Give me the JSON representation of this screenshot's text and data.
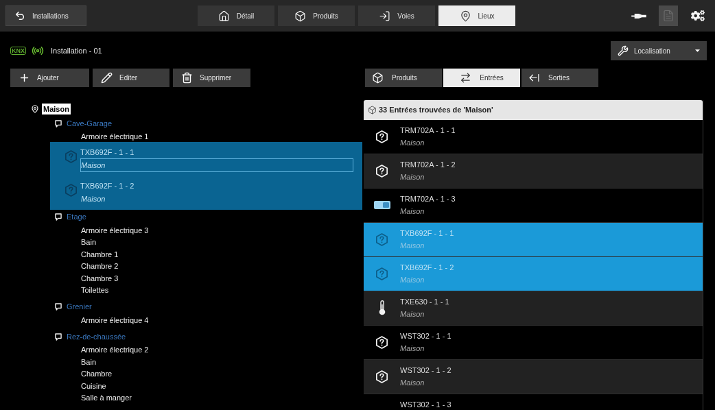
{
  "top_bar": {
    "back_button": "Installations",
    "tabs": [
      {
        "label": "Détail",
        "selected": false
      },
      {
        "label": "Produits",
        "selected": false
      },
      {
        "label": "Voies",
        "selected": false
      },
      {
        "label": "Lieux",
        "selected": true
      }
    ],
    "tools": [
      {
        "kind": "plug",
        "disabled": false
      },
      {
        "kind": "document",
        "disabled": true
      },
      {
        "kind": "settings",
        "disabled": false
      }
    ]
  },
  "installation": {
    "logo": "KNX",
    "name": "Installation - 01"
  },
  "view_menu": {
    "label": "Localisation"
  },
  "actions": [
    "Ajouter",
    "Editer",
    "Supprimer"
  ],
  "filter_tabs": [
    {
      "label": "Produits",
      "selected": false
    },
    {
      "label": "Entrées",
      "selected": true
    },
    {
      "label": "Sorties",
      "selected": false
    }
  ],
  "tree": {
    "label": "Maison",
    "selected": true,
    "children": [
      {
        "label": "Cave-Garage",
        "selected": false,
        "children": [
          {
            "label": "Armoire électrique 1",
            "selected": false
          }
        ],
        "drag_preview": {
          "items": [
            {
              "title": "TXB692F - 1 - 1",
              "location": "Maison",
              "highlighted": true
            },
            {
              "title": "TXB692F - 1 - 2",
              "location": "Maison",
              "highlighted": false
            }
          ]
        }
      },
      {
        "label": "Etage",
        "selected": false,
        "children": [
          {
            "label": "Armoire électrique 3",
            "selected": false
          },
          {
            "label": "Bain",
            "selected": false
          },
          {
            "label": "Chambre 1",
            "selected": false
          },
          {
            "label": "Chambre 2",
            "selected": false
          },
          {
            "label": "Chambre 3",
            "selected": false
          },
          {
            "label": "Toilettes",
            "selected": false
          }
        ]
      },
      {
        "label": "Grenier",
        "selected": false,
        "children": [
          {
            "label": "Armoire électrique 4",
            "selected": false
          }
        ]
      },
      {
        "label": "Rez-de-chaussée",
        "selected": false,
        "children": [
          {
            "label": "Armoire électrique 2",
            "selected": false
          },
          {
            "label": "Bain",
            "selected": false
          },
          {
            "label": "Chambre",
            "selected": false
          },
          {
            "label": "Cuisine",
            "selected": false
          },
          {
            "label": "Salle à manger",
            "selected": false
          }
        ]
      }
    ]
  },
  "results": {
    "heading": "33 Entrées trouvées de 'Maison'",
    "rows": [
      {
        "kind": "unknown",
        "title": "TRM702A - 1 - 1",
        "location": "Maison",
        "selected": false
      },
      {
        "kind": "unknown",
        "title": "TRM702A - 1 - 2",
        "location": "Maison",
        "selected": false
      },
      {
        "kind": "switch",
        "title": "TRM702A - 1 - 3",
        "location": "Maison",
        "selected": false
      },
      {
        "kind": "unknown",
        "title": "TXB692F - 1 - 1",
        "location": "Maison",
        "selected": true
      },
      {
        "kind": "unknown",
        "title": "TXB692F - 1 - 2",
        "location": "Maison",
        "selected": true
      },
      {
        "kind": "temperature",
        "title": "TXE630 - 1 - 1",
        "location": "Maison",
        "selected": false
      },
      {
        "kind": "unknown",
        "title": "WST302 - 1 - 1",
        "location": "Maison",
        "selected": false
      },
      {
        "kind": "unknown",
        "title": "WST302 - 1 - 2",
        "location": "Maison",
        "selected": false
      },
      {
        "title": "WST302 - 1 - 3",
        "selected": false
      }
    ]
  }
}
